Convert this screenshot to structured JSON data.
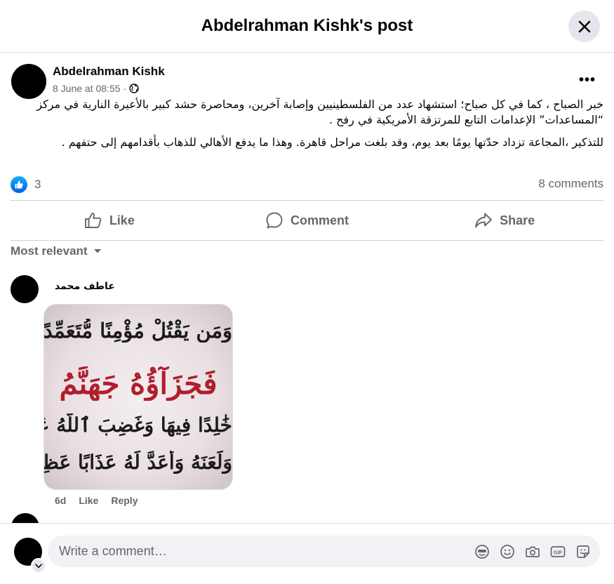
{
  "header": {
    "title": "Abdelrahman Kishk's post"
  },
  "post": {
    "author": "Abdelrahman Kishk",
    "timestamp": "8 June at 08:55",
    "separator": "·",
    "paragraphs": [
      "خبر الصباح ، كما في كل صباح؛ استشهاد عدد من الفلسطينيين وإصابة آخرين، ومحاصرة حشد كبير بالأعيرة النارية في مركز “المساعدات” الإعدامات التابع للمرتزقة الأمريكية في رفح .",
      "للتذكير ،المجاعة تزداد حدّتها يومًا بعد يوم، وقد بلغت مراحل قاهرة. وهذا ما يدفع الأهالي للذهاب بأقدامهم إلى حتفهم ."
    ],
    "reaction_count": "3",
    "comments_count": "8 comments"
  },
  "actions": {
    "like": "Like",
    "comment": "Comment",
    "share": "Share"
  },
  "sort_label": "Most relevant",
  "comment": {
    "author": "عاطف محمد",
    "image_lines": [
      "وَمَن يَقْتُلْ مُؤْمِنًا مُّتَعَمِّدًا",
      "فَجَزَآؤُهُ جَهَنَّمُ",
      "خَٰلِدًا فِيهَا وَغَضِبَ ٱللَّهُ عَلَيْهِ",
      "وَلَعَنَهُ وَأَعَدَّ لَهُ عَذَابًا عَظِيمًا"
    ],
    "time": "6d",
    "like_label": "Like",
    "reply_label": "Reply"
  },
  "composer": {
    "placeholder": "Write a comment…"
  },
  "icons": {
    "close": "close-icon",
    "globe": "globe-icon",
    "more": "more-icon",
    "thumbs": "thumbs-up-icon",
    "comment": "comment-icon",
    "share": "share-icon",
    "caret": "caret-down-icon",
    "avatar_sticker": "avatar-sticker-icon",
    "emoji": "emoji-icon",
    "camera": "camera-icon",
    "gif": "gif-icon",
    "sticker": "sticker-icon"
  },
  "colors": {
    "like_blue": "#0866ff",
    "secondary_text": "#65676b",
    "divider": "#ced0d4",
    "quran_red": "#b01e2d",
    "quran_black": "#1b1b1b"
  }
}
